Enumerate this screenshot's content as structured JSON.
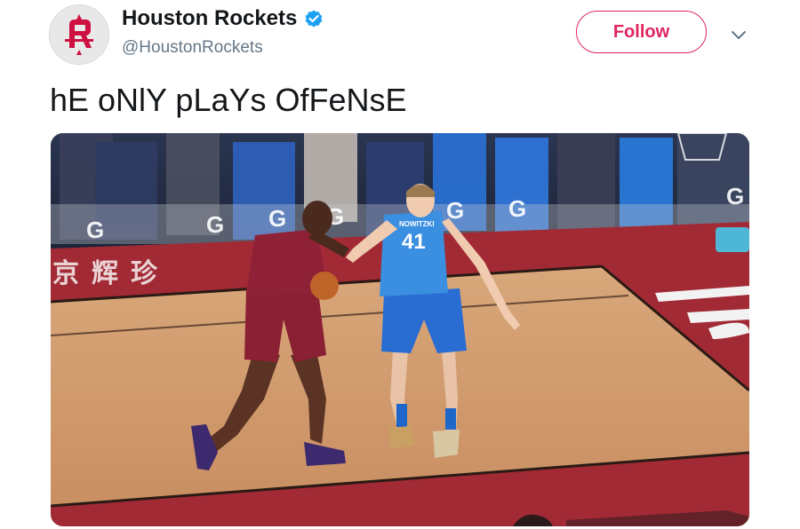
{
  "tweet": {
    "display_name": "Houston Rockets",
    "handle": "@HoustonRockets",
    "verified": true,
    "follow_label": "Follow",
    "text": "hE oNlY pLaYs OfFeNsE"
  },
  "media": {
    "jersey_number": "41",
    "jersey_name": "NOWITZKI",
    "court_text": "京辉珍",
    "ad_letter": "G"
  },
  "colors": {
    "accent": "#e0245e",
    "verified": "#1da1f2",
    "text": "#14171a",
    "secondary_text": "#657786",
    "rockets_red": "#ce1141"
  },
  "icons": {
    "avatar": "houston-rockets-logo",
    "verified": "verified-badge-icon",
    "caret": "chevron-down-icon"
  }
}
